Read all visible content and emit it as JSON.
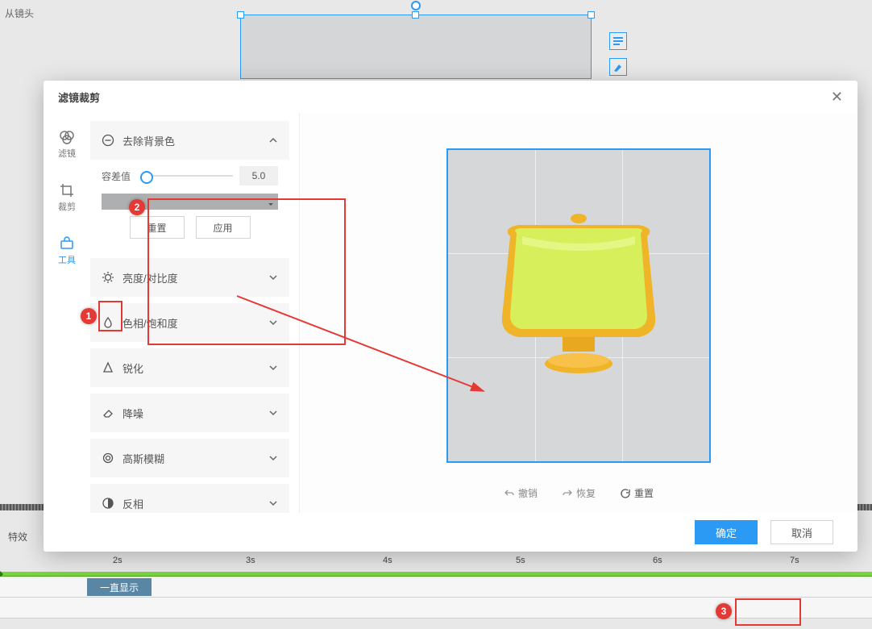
{
  "bg": {
    "label": "从镜头"
  },
  "side_tool_icons": [
    "list-icon",
    "fill-icon",
    "brush-icon"
  ],
  "timeline": {
    "effects_label": "特效",
    "marks": [
      "2s",
      "3s",
      "4s",
      "5s",
      "6s",
      "7s"
    ],
    "clip_label": "一直显示"
  },
  "modal": {
    "title": "滤镜裁剪",
    "sidetabs": [
      {
        "label": "滤镜",
        "icon": "filter-icon"
      },
      {
        "label": "裁剪",
        "icon": "crop-icon"
      },
      {
        "label": "工具",
        "icon": "toolbox-icon"
      }
    ],
    "panel": {
      "remove_bg": {
        "title": "去除背景色",
        "tolerance_label": "容差值",
        "tolerance_value": "5.0",
        "reset": "重置",
        "apply": "应用"
      },
      "items": [
        {
          "label": "亮度/对比度"
        },
        {
          "label": "色相/饱和度"
        },
        {
          "label": "锐化"
        },
        {
          "label": "降噪"
        },
        {
          "label": "高斯模糊"
        },
        {
          "label": "反相"
        }
      ]
    },
    "preview_actions": {
      "undo": "撤销",
      "redo": "恢复",
      "reset": "重置"
    },
    "ok": "确定",
    "cancel": "取消"
  },
  "callouts": [
    "1",
    "2",
    "3"
  ]
}
